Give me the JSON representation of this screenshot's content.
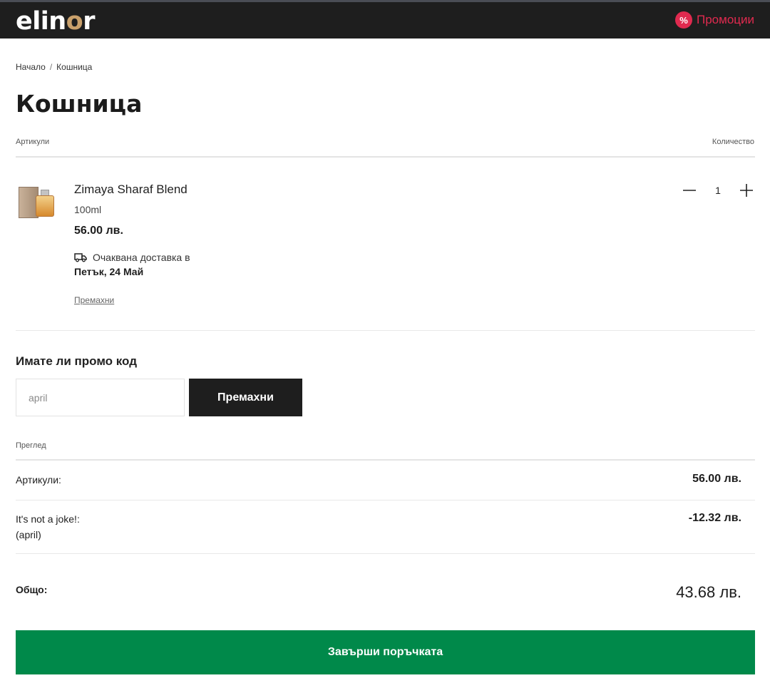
{
  "header": {
    "logo_prefix": "elin",
    "logo_accent": "o",
    "logo_suffix": "r",
    "promotions_label": "Промоции",
    "promotions_icon": "%"
  },
  "breadcrumb": {
    "home": "Начало",
    "separator": "/",
    "current": "Кошница"
  },
  "page_title": "Кошница",
  "columns": {
    "items": "Артикули",
    "quantity": "Количество"
  },
  "cart_item": {
    "name": "Zimaya Sharaf Blend",
    "size": "100ml",
    "price": "56.00 лв.",
    "delivery_label": "Очаквана доставка в",
    "delivery_date": "Петък, 24 Май",
    "remove_label": "Премахни",
    "quantity": "1"
  },
  "promo": {
    "title": "Имате ли промо код",
    "code_value": "april",
    "button_label": "Премахни"
  },
  "summary": {
    "heading": "Преглед",
    "items_label": "Артикули:",
    "items_value": "56.00 лв.",
    "discount_label_line1": "It's not a joke!:",
    "discount_label_line2": "(april)",
    "discount_value": "-12.32 лв.",
    "total_label": "Общо:",
    "total_value": "43.68 лв."
  },
  "checkout_label": "Завърши поръчката",
  "colors": {
    "accent": "#c9a06b",
    "promo": "#e02a4f",
    "checkout": "#00894a",
    "dark": "#1e1e1e"
  }
}
